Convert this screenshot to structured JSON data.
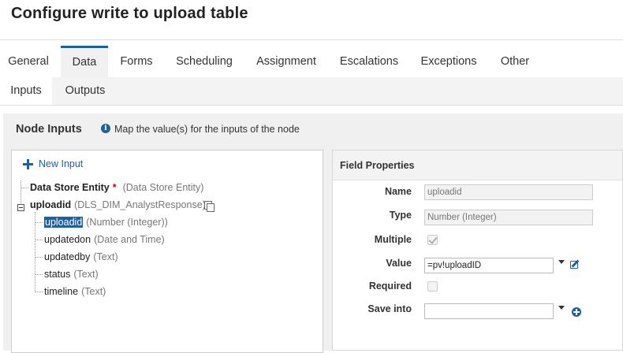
{
  "window": {
    "title": "Configure write to upload table"
  },
  "tabs": [
    {
      "label": "General"
    },
    {
      "label": "Data",
      "active": true
    },
    {
      "label": "Forms"
    },
    {
      "label": "Scheduling"
    },
    {
      "label": "Assignment"
    },
    {
      "label": "Escalations"
    },
    {
      "label": "Exceptions"
    },
    {
      "label": "Other"
    }
  ],
  "subtabs": [
    {
      "label": "Inputs",
      "active": true
    },
    {
      "label": "Outputs"
    }
  ],
  "node_inputs": {
    "title": "Node Inputs",
    "info_text": "Map the value(s) for the inputs of the node",
    "new_input_label": "New Input",
    "tree": {
      "data_store_entity": {
        "name": "Data Store Entity",
        "required_mark": "*",
        "type": "(Data Store Entity)"
      },
      "uploadid_parent": {
        "name": "uploadid",
        "type": "(DLS_DIM_AnalystResponse)"
      },
      "children": [
        {
          "name": "uploadid",
          "type": "(Number (Integer))",
          "selected": true
        },
        {
          "name": "updatedon",
          "type": "(Date and Time)"
        },
        {
          "name": "updatedby",
          "type": "(Text)"
        },
        {
          "name": "status",
          "type": "(Text)"
        },
        {
          "name": "timeline",
          "type": "(Text)"
        }
      ]
    }
  },
  "field_properties": {
    "title": "Field Properties",
    "name_label": "Name",
    "name_value": "uploadid",
    "type_label": "Type",
    "type_value": "Number (Integer)",
    "multiple_label": "Multiple",
    "multiple_checked": true,
    "value_label": "Value",
    "value_value": "=pv!uploadID",
    "required_label": "Required",
    "required_checked": false,
    "save_into_label": "Save into",
    "save_into_value": ""
  },
  "icons": {
    "info": "info-icon",
    "new_input": "plus-icon",
    "copy": "copy-icon",
    "edit": "edit-icon",
    "add": "add-circle-icon"
  },
  "colors": {
    "accent": "#1f5f9b",
    "required": "#d0021b"
  }
}
